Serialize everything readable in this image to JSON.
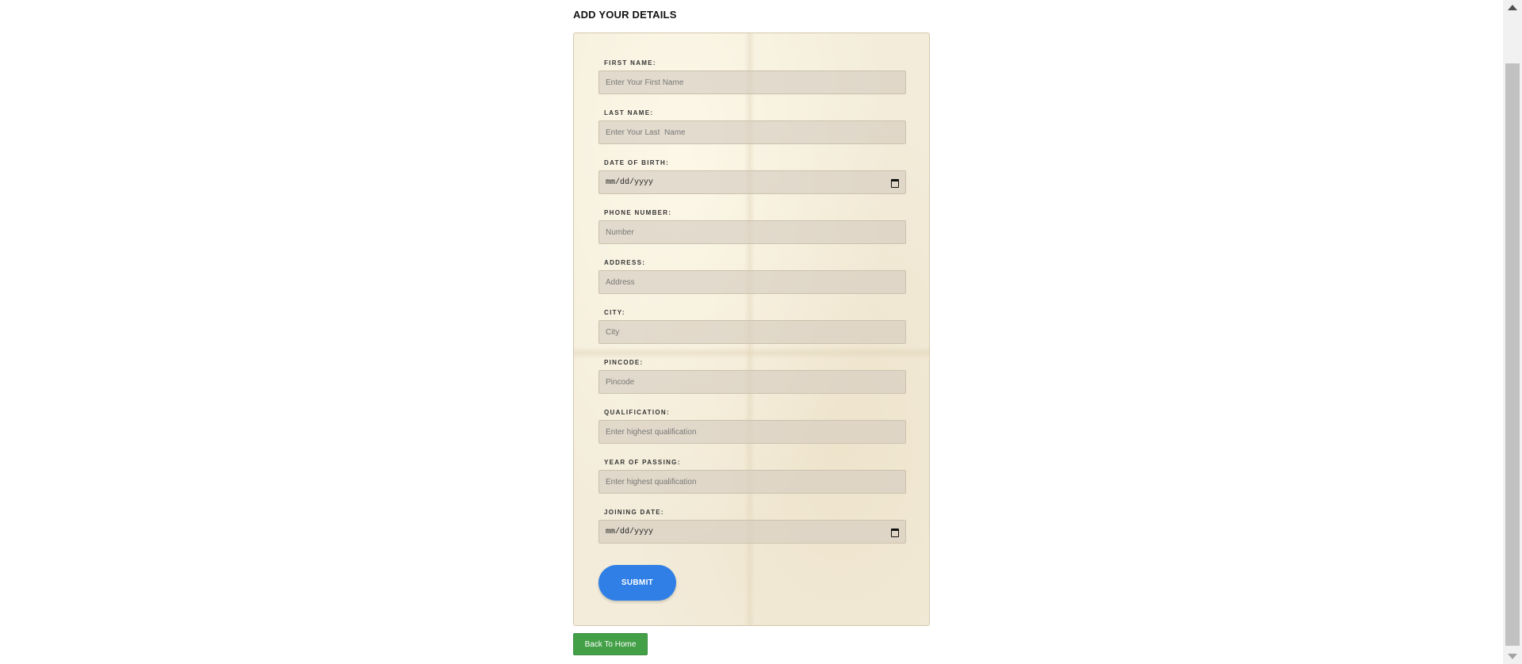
{
  "page": {
    "title": "ADD YOUR DETAILS"
  },
  "form": {
    "fields": [
      {
        "label": "FIRST NAME:",
        "placeholder": "Enter Your First Name",
        "type": "text"
      },
      {
        "label": "LAST NAME:",
        "placeholder": "Enter Your Last  Name",
        "type": "text"
      },
      {
        "label": "DATE OF BIRTH:",
        "value": "mm/dd/yyyy",
        "type": "date"
      },
      {
        "label": "PHONE NUMBER:",
        "placeholder": "Number",
        "type": "text"
      },
      {
        "label": "ADDRESS:",
        "placeholder": "Address",
        "type": "text"
      },
      {
        "label": "CITY:",
        "placeholder": "City",
        "type": "text"
      },
      {
        "label": "PINCODE:",
        "placeholder": "Pincode",
        "type": "text"
      },
      {
        "label": "QUALIFICATION:",
        "placeholder": "Enter highest qualification",
        "type": "text"
      },
      {
        "label": "YEAR OF PASSING:",
        "placeholder": "Enter highest qualification",
        "type": "text"
      },
      {
        "label": "JOINING DATE:",
        "value": "mm/dd/yyyy",
        "type": "date"
      }
    ],
    "submit_label": "SUBMIT"
  },
  "back_button_label": "Back To Home",
  "icons": {
    "date_picker": "calendar-icon",
    "scroll_up": "scroll-up-arrow-icon",
    "scroll_down": "scroll-down-arrow-icon"
  },
  "colors": {
    "submit": "#2f7fe6",
    "back": "#43a047",
    "card_bg": "#f3ecda",
    "input_bg": "#dcd4c6"
  }
}
